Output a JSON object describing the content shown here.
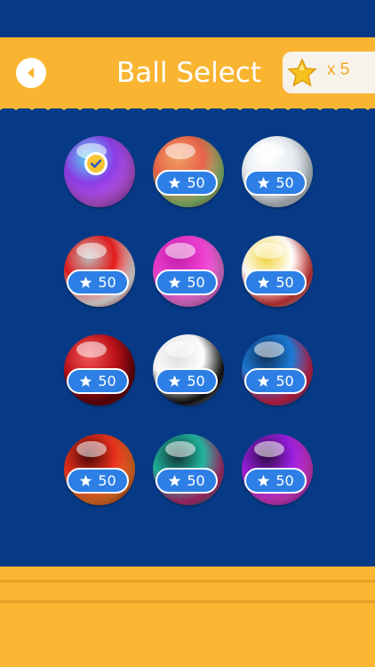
{
  "header": {
    "title": "Ball Select",
    "coin_count": "x 5"
  },
  "balls": [
    {
      "name": "ball-purple-basketball",
      "selected": true,
      "price": "",
      "colors": [
        "#8b3de6",
        "#c85ae8",
        "#4fd8f0"
      ]
    },
    {
      "name": "ball-beach-stripes",
      "selected": false,
      "price": "50",
      "colors": [
        "#e8634a",
        "#8fd07a",
        "#f0a060"
      ]
    },
    {
      "name": "ball-golf-white",
      "selected": false,
      "price": "50",
      "colors": [
        "#e9eef2",
        "#c7d2da",
        "#ffffff"
      ]
    },
    {
      "name": "ball-red-white",
      "selected": false,
      "price": "50",
      "colors": [
        "#e41b1b",
        "#ffffff",
        "#bbbbbb"
      ]
    },
    {
      "name": "ball-pink-golf",
      "selected": false,
      "price": "50",
      "colors": [
        "#ef3fd2",
        "#f77ee5",
        "#c01ea8"
      ]
    },
    {
      "name": "ball-volleyball",
      "selected": false,
      "price": "50",
      "colors": [
        "#ffffff",
        "#e03a3a",
        "#f1d13a"
      ]
    },
    {
      "name": "ball-red-swirl",
      "selected": false,
      "price": "50",
      "colors": [
        "#c0121a",
        "#6d0508",
        "#f25a5a"
      ]
    },
    {
      "name": "ball-soccer",
      "selected": false,
      "price": "50",
      "colors": [
        "#ffffff",
        "#111111",
        "#dddddd"
      ]
    },
    {
      "name": "ball-blue-red-swirl",
      "selected": false,
      "price": "50",
      "colors": [
        "#1c7bd6",
        "#e0204a",
        "#0d2d55"
      ]
    },
    {
      "name": "ball-fire-swirl",
      "selected": false,
      "price": "50",
      "colors": [
        "#e6301c",
        "#f47a2a",
        "#4a0606"
      ]
    },
    {
      "name": "ball-teal-swirl",
      "selected": false,
      "price": "50",
      "colors": [
        "#20b59e",
        "#c52c79",
        "#103030"
      ]
    },
    {
      "name": "ball-violet-swirl",
      "selected": false,
      "price": "50",
      "colors": [
        "#9a1fe0",
        "#e43fd0",
        "#2a0a40"
      ]
    }
  ]
}
